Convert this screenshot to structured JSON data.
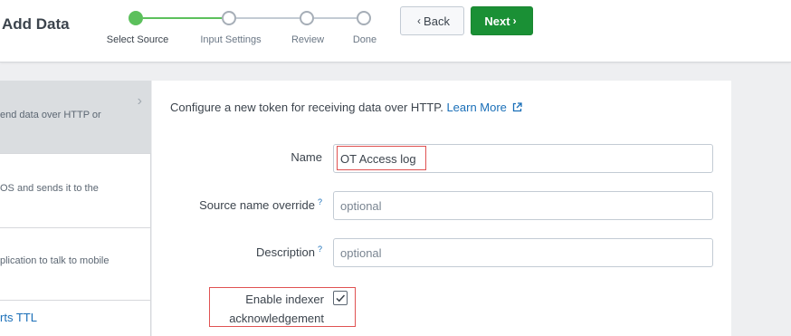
{
  "header": {
    "title": "Add Data",
    "steps": [
      {
        "label": "Select Source",
        "state": "active"
      },
      {
        "label": "Input Settings",
        "state": "pending"
      },
      {
        "label": "Review",
        "state": "pending"
      },
      {
        "label": "Done",
        "state": "pending"
      }
    ],
    "back_label": "Back",
    "next_label": "Next"
  },
  "sidebar": {
    "items": [
      {
        "text": "end data over HTTP or",
        "selected": true
      },
      {
        "text": "OS and sends it to the",
        "selected": false
      },
      {
        "text": "plication to talk to mobile",
        "selected": false
      }
    ],
    "link_text": "rts TTL"
  },
  "form": {
    "intro_text": "Configure a new token for receiving data over HTTP.",
    "learn_more": "Learn More",
    "name_label": "Name",
    "name_value": "OT Access log",
    "source_label": "Source name override",
    "source_placeholder": "optional",
    "description_label": "Description",
    "description_placeholder": "optional",
    "help_mark": "?",
    "ack_label": "Enable indexer acknowledgement",
    "ack_checked": true
  },
  "colors": {
    "accent_green": "#1a9035",
    "link_blue": "#1a6fb8",
    "highlight_red": "#e05252"
  }
}
